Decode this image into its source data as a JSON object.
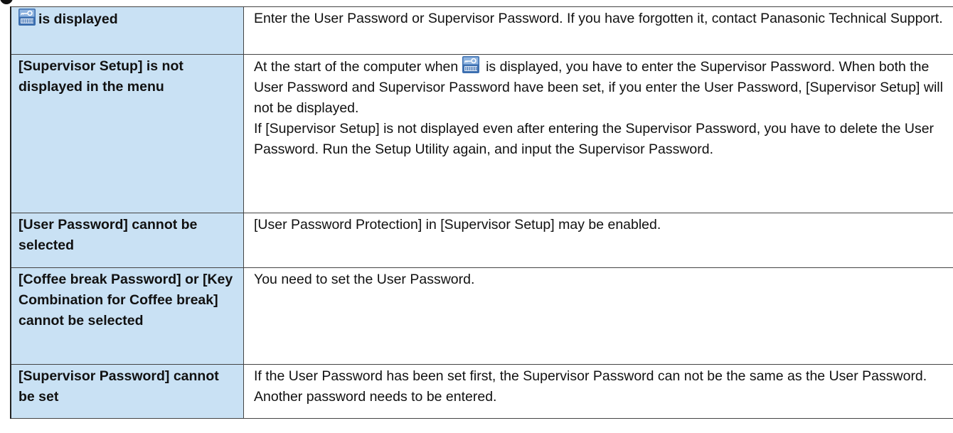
{
  "icons": {
    "password_prompt": "password-key-icon"
  },
  "colors": {
    "problem_cell_bg": "#c9e1f4",
    "border": "#444444",
    "icon_bg": "#3c6fb0"
  },
  "rows": [
    {
      "problem_suffix": "is displayed",
      "solution_paragraphs": [
        "Enter the User Password or Supervisor Password.  If you have forgotten it, contact Panasonic Technical Support."
      ]
    },
    {
      "problem": "[Supervisor Setup] is not displayed in the menu",
      "solution_prefix": "At the start of the computer when",
      "solution_suffix": "is displayed, you have to enter the Supervisor Password.  When both the User Password and Supervisor Password have been set, if you enter the User Password, [Supervisor Setup] will not be displayed.",
      "solution_extra": "If  [Supervisor Setup] is not displayed even after entering the Supervisor Password, you have to delete the User Password.  Run the Setup Utility again, and input the Supervisor Password."
    },
    {
      "problem": "[User Password] cannot be selected",
      "solution": "[User Password Protection] in [Supervisor Setup] may be enabled."
    },
    {
      "problem": "[Coffee break Password] or [Key Combination for Coffee break] cannot be selected",
      "solution": "You need to set the User Password."
    },
    {
      "problem": "[Supervisor Password] cannot be set",
      "solution": "If the User Password has been set first, the Supervisor Password can not be the same as the User Password.  Another password needs to be entered."
    }
  ]
}
